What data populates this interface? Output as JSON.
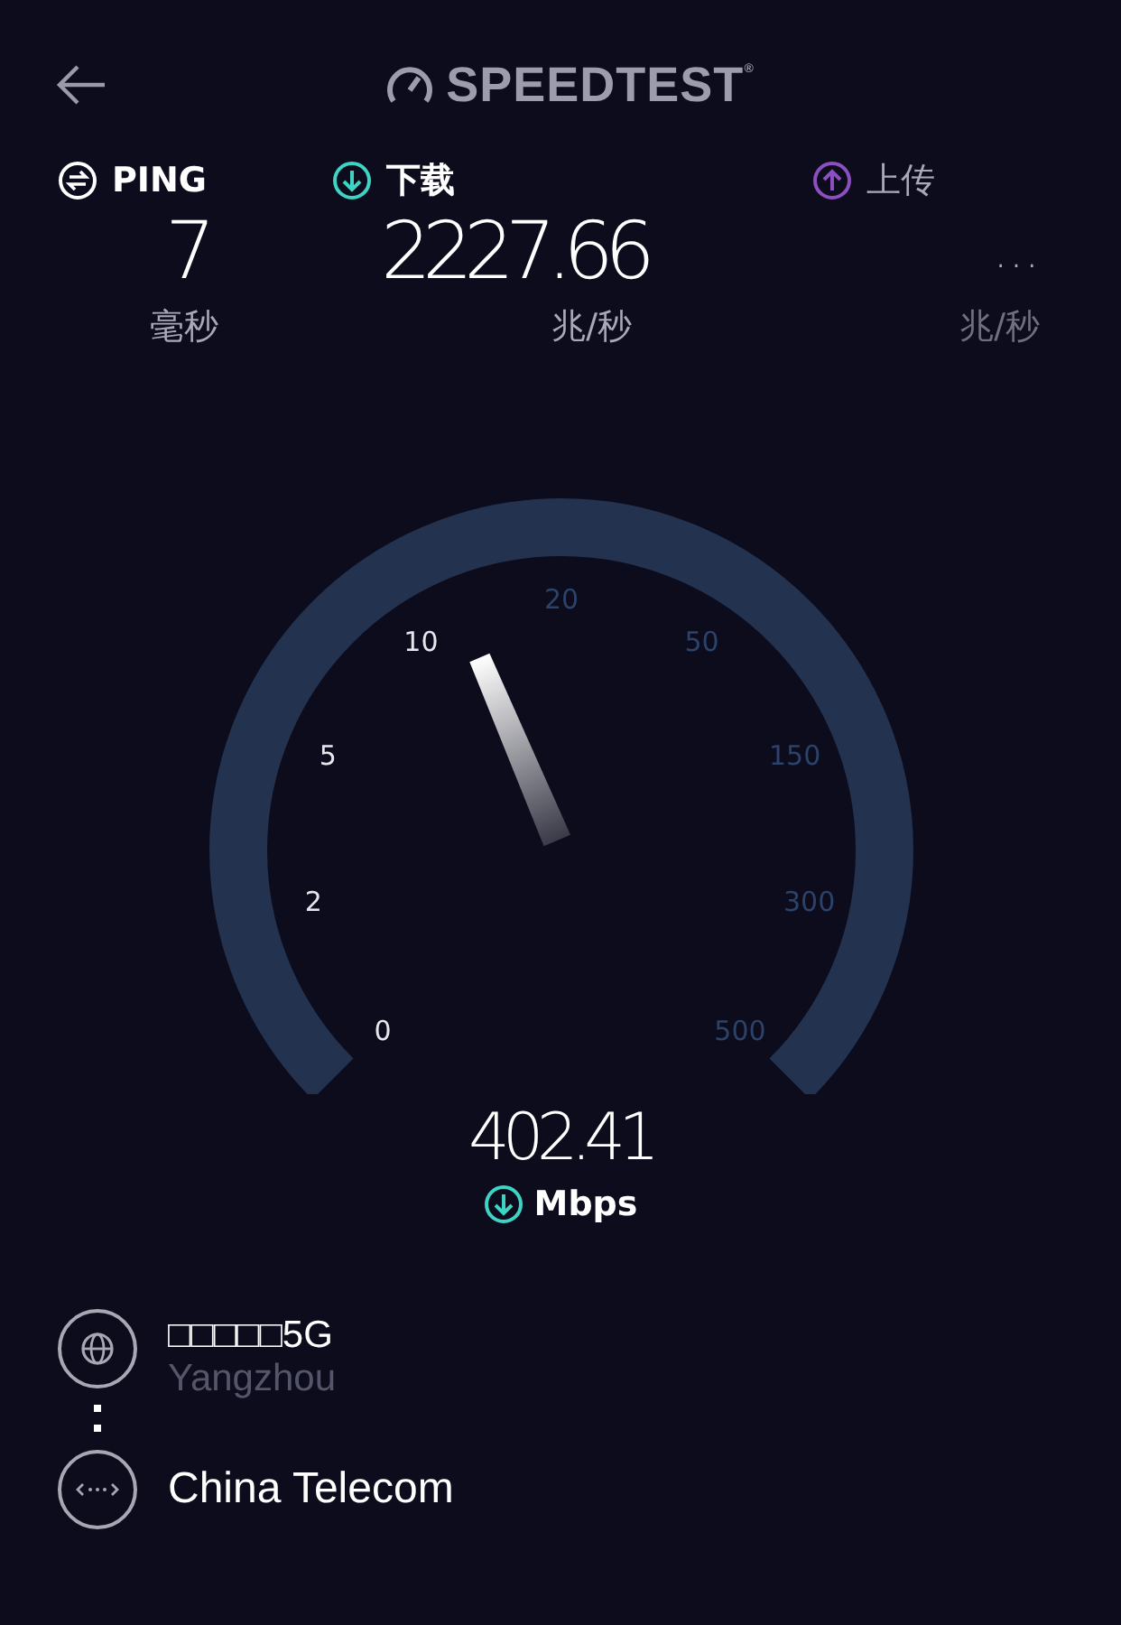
{
  "header": {
    "title": "SPEEDTEST$^{®}$"
  },
  "stats": [
    {
      "kind": "ping",
      "label": "PING",
      "value": "7",
      "unit": "毫秒",
      "active": true
    },
    {
      "kind": "download",
      "label": "下载",
      "value": "2227.66",
      "unit": "兆/秒",
      "active": true
    },
    {
      "kind": "upload",
      "label": "上传",
      "value": "…",
      "unit": "兆/秒",
      "active": false
    }
  ],
  "gauge": {
    "reading": "402.41",
    "unit": "Mbps",
    "ticks": [
      {
        "label": "0",
        "passed": true
      },
      {
        "label": "2",
        "passed": true
      },
      {
        "label": "5",
        "passed": true
      },
      {
        "label": "10",
        "passed": true
      },
      {
        "label": "20",
        "passed": false
      },
      {
        "label": "50",
        "passed": false
      },
      {
        "label": "150",
        "passed": false
      },
      {
        "label": "300",
        "passed": false
      },
      {
        "label": "500",
        "passed": false
      }
    ]
  },
  "server": {
    "name": "□□□□□5G",
    "location": "Yangzhou"
  },
  "isp": {
    "name": "China Telecom"
  }
}
